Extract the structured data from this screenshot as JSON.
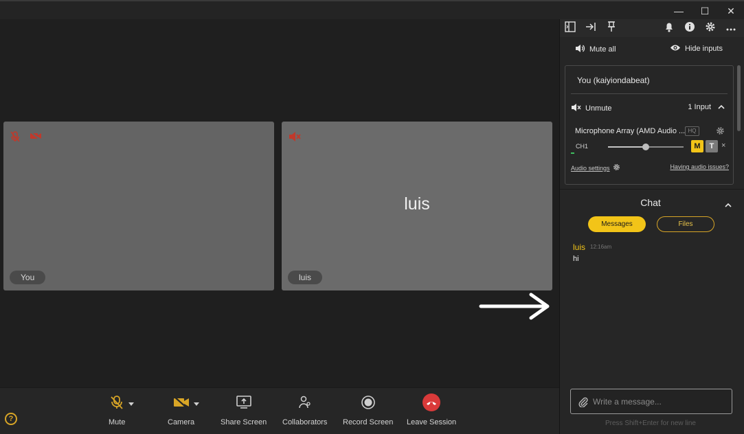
{
  "window": {
    "minimize": "—",
    "maximize": "☐",
    "close": "✕"
  },
  "tiles": [
    {
      "name": "You",
      "center": ""
    },
    {
      "name": "luis",
      "center": "luis"
    }
  ],
  "toolbar": {
    "mute": "Mute",
    "camera": "Camera",
    "share": "Share Screen",
    "collaborators": "Collaborators",
    "record": "Record Screen",
    "leave": "Leave Session"
  },
  "colors": {
    "accent": "#f2c418",
    "danger": "#d93a3a",
    "muted_red": "#c0392b"
  },
  "panel": {
    "mute_all": "Mute all",
    "hide_inputs": "Hide inputs",
    "input": {
      "owner": "You (kaiyiondabeat)",
      "unmute": "Unmute",
      "input_count": "1 Input",
      "device": "Microphone Array (AMD Audio ...",
      "hq": "HQ",
      "channel": "CH1",
      "volume": 0.5,
      "m_label": "M",
      "t_label": "T",
      "remove": "×",
      "audio_settings": "Audio settings",
      "audio_issues": "Having audio issues?"
    },
    "chat": {
      "title": "Chat",
      "tab_messages": "Messages",
      "tab_files": "Files",
      "messages": [
        {
          "author": "luis",
          "time": "12:16am",
          "text": "hi"
        }
      ],
      "placeholder": "Write a message...",
      "hint": "Press Shift+Enter for new line"
    }
  }
}
